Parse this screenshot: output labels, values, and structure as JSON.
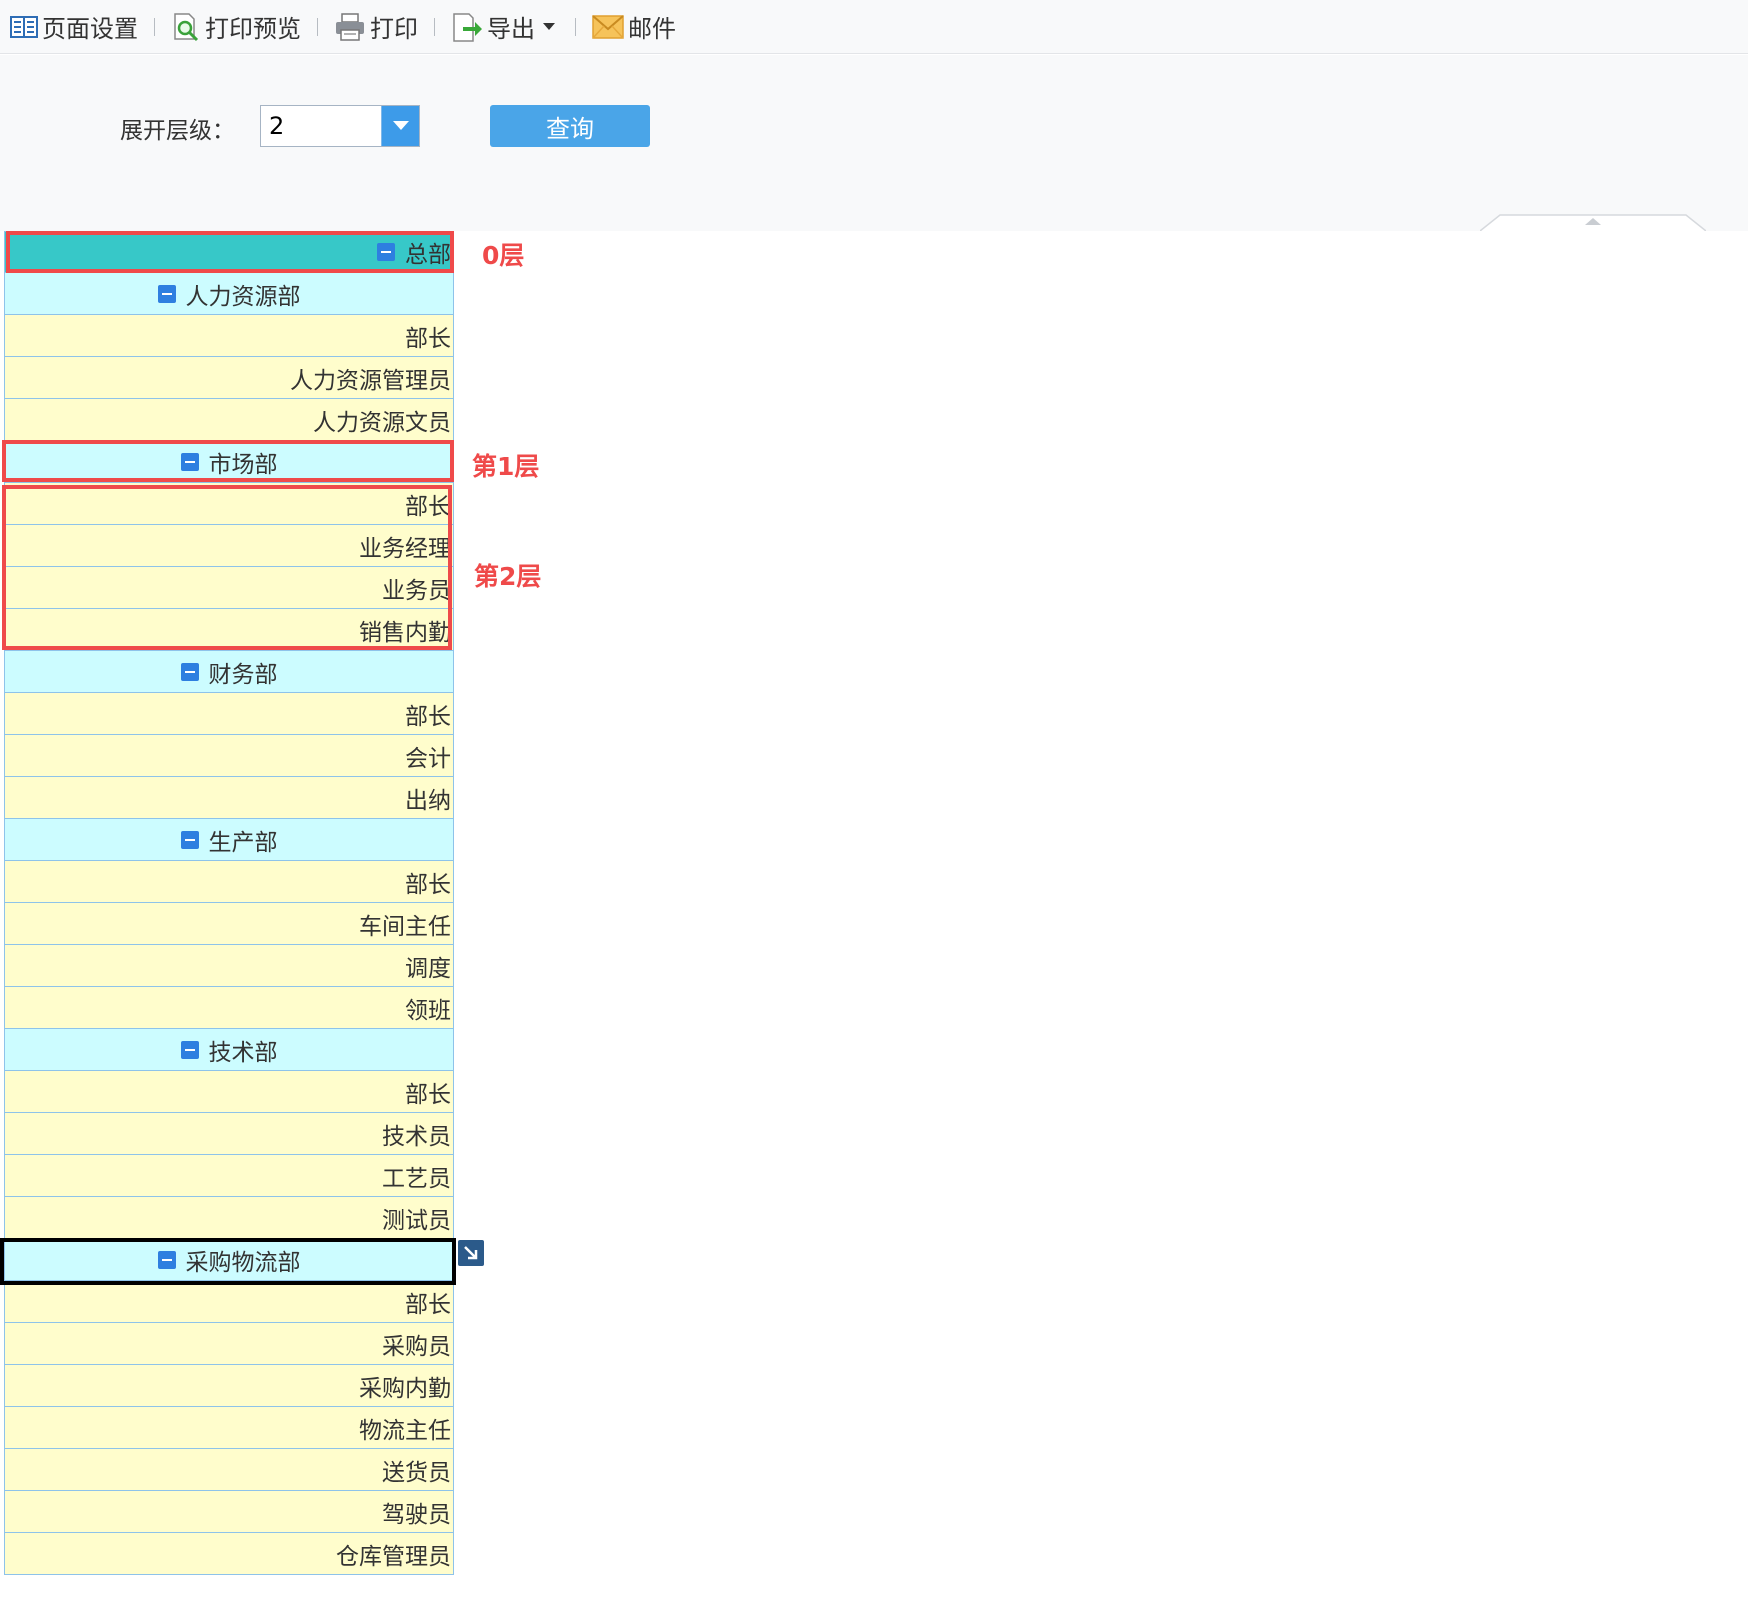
{
  "toolbar": {
    "items": [
      {
        "label": "页面设置",
        "icon": "page-setup-icon"
      },
      {
        "label": "打印预览",
        "icon": "print-preview-icon"
      },
      {
        "label": "打印",
        "icon": "printer-icon"
      },
      {
        "label": "导出",
        "icon": "export-icon"
      },
      {
        "label": "邮件",
        "icon": "mail-icon"
      }
    ]
  },
  "query": {
    "level_label": "展开层级：",
    "level_value": "2",
    "submit_label": "查询"
  },
  "tree": {
    "root": "总部",
    "rows": [
      {
        "level": 1,
        "label": "人力资源部"
      },
      {
        "level": 2,
        "label": "部长"
      },
      {
        "level": 2,
        "label": "人力资源管理员"
      },
      {
        "level": 2,
        "label": "人力资源文员"
      },
      {
        "level": 1,
        "label": "市场部"
      },
      {
        "level": 2,
        "label": "部长"
      },
      {
        "level": 2,
        "label": "业务经理"
      },
      {
        "level": 2,
        "label": "业务员"
      },
      {
        "level": 2,
        "label": "销售内勤"
      },
      {
        "level": 1,
        "label": "财务部"
      },
      {
        "level": 2,
        "label": "部长"
      },
      {
        "level": 2,
        "label": "会计"
      },
      {
        "level": 2,
        "label": "出纳"
      },
      {
        "level": 1,
        "label": "生产部"
      },
      {
        "level": 2,
        "label": "部长"
      },
      {
        "level": 2,
        "label": "车间主任"
      },
      {
        "level": 2,
        "label": "调度"
      },
      {
        "level": 2,
        "label": "领班"
      },
      {
        "level": 1,
        "label": "技术部"
      },
      {
        "level": 2,
        "label": "部长"
      },
      {
        "level": 2,
        "label": "技术员"
      },
      {
        "level": 2,
        "label": "工艺员"
      },
      {
        "level": 2,
        "label": "测试员"
      },
      {
        "level": 1,
        "label": "采购物流部"
      },
      {
        "level": 2,
        "label": "部长"
      },
      {
        "level": 2,
        "label": "采购员"
      },
      {
        "level": 2,
        "label": "采购内勤"
      },
      {
        "level": 2,
        "label": "物流主任"
      },
      {
        "level": 2,
        "label": "送货员"
      },
      {
        "level": 2,
        "label": "驾驶员"
      },
      {
        "level": 2,
        "label": "仓库管理员"
      }
    ]
  },
  "annotations": {
    "level0": "0层",
    "level1": "第1层",
    "level2": "第2层"
  },
  "colors": {
    "root_bg": "#37c8c8",
    "level1_bg": "#ccfcff",
    "level2_bg": "#fffdcc",
    "annotation": "#ef4a4a",
    "accent": "#4aa5e8"
  }
}
